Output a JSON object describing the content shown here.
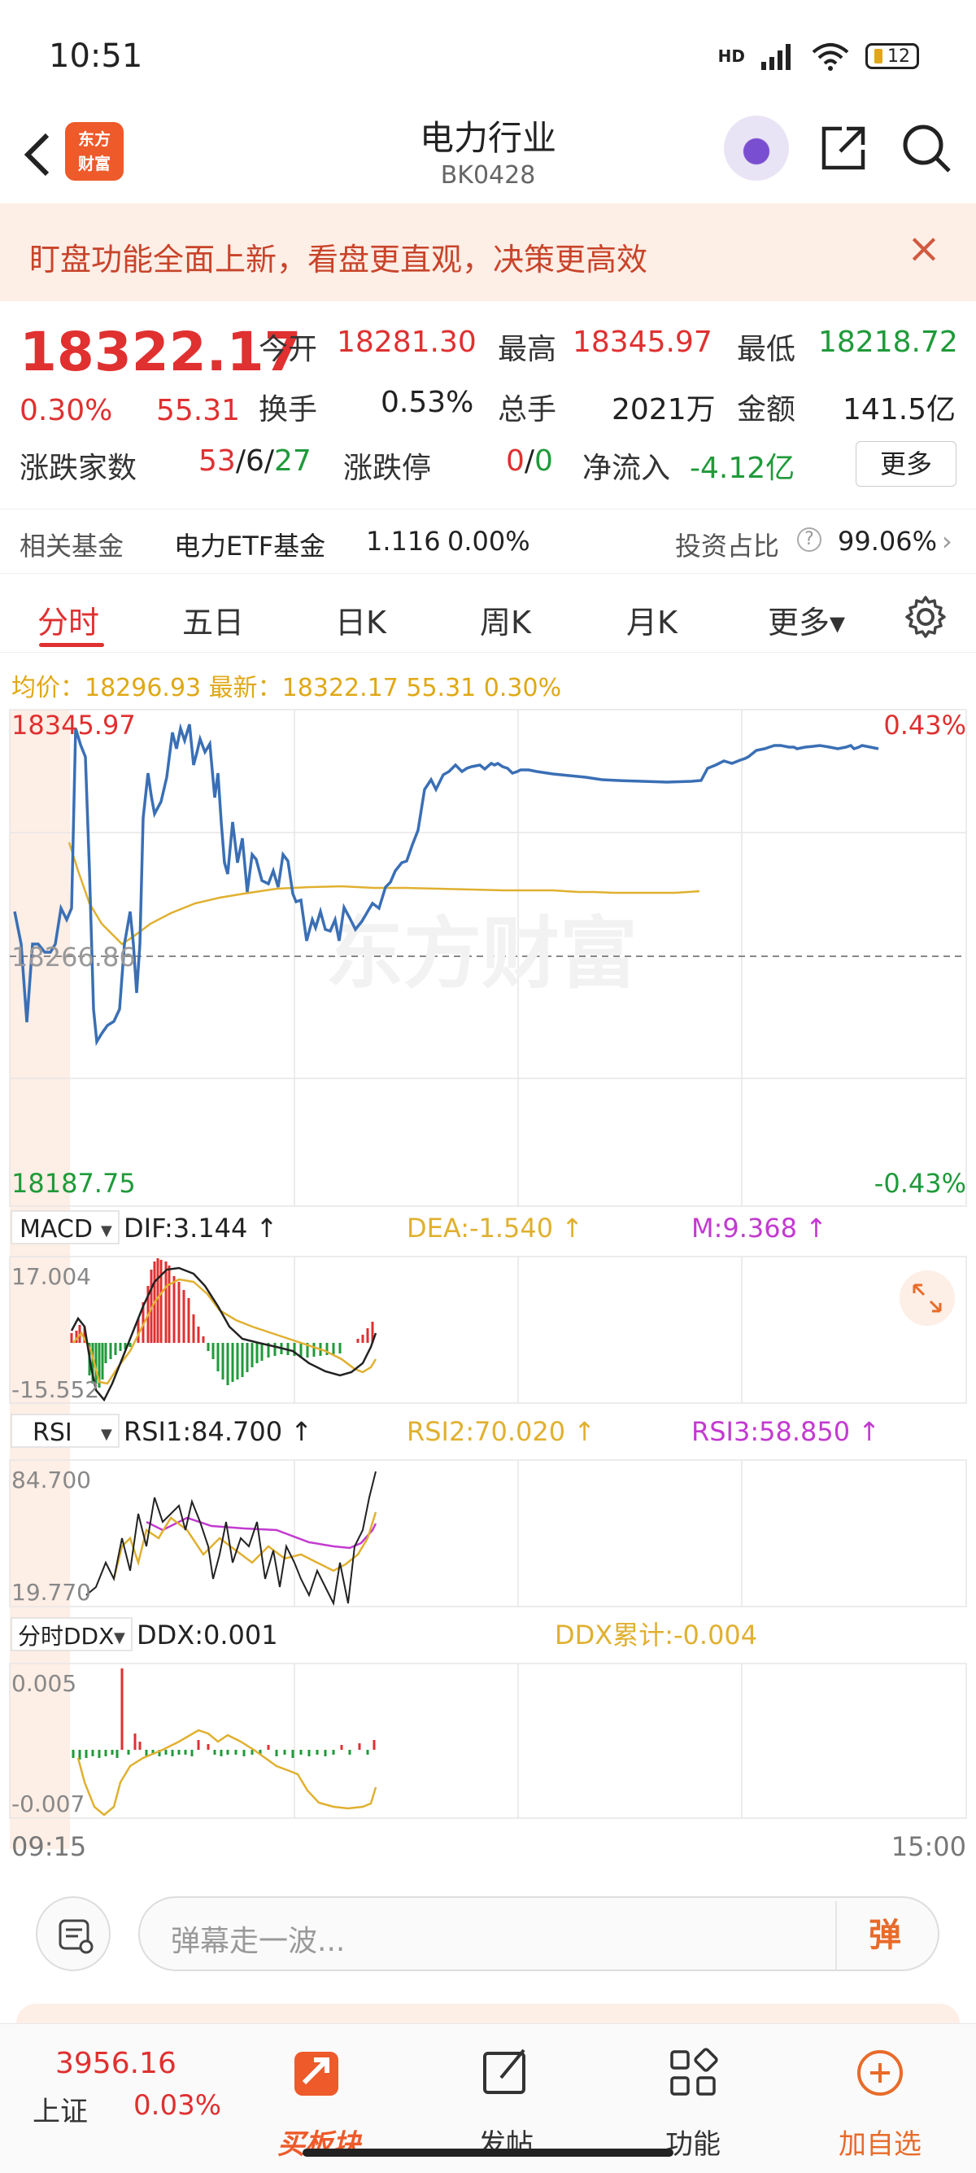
{
  "status_bar": {
    "time": "10:51",
    "network": "HD",
    "battery": "12"
  },
  "nav": {
    "title": "电力行业",
    "code": "BK0428",
    "logo_text": "东方财富"
  },
  "banner": {
    "text": "盯盘功能全面上新，看盘更直观，决策更高效",
    "close": "×"
  },
  "quote": {
    "last_price": "18322.17",
    "change_pct": "0.30%",
    "change_val": "55.31",
    "open_label": "今开",
    "open": "18281.30",
    "high_label": "最高",
    "high": "18345.97",
    "low_label": "最低",
    "low": "18218.72",
    "turnover_label": "换手",
    "turnover": "0.53%",
    "volume_label": "总手",
    "volume": "2021万",
    "amount_label": "金额",
    "amount": "141.5亿",
    "breadth_label": "涨跌家数",
    "breadth_up": "53",
    "breadth_flat": "6",
    "breadth_down": "27",
    "limit_label": "涨跌停",
    "limit_up": "0",
    "limit_down": "0",
    "netflow_label": "净流入",
    "netflow": "-4.12亿",
    "more_button": "更多"
  },
  "fund": {
    "label": "相关基金",
    "name": "电力ETF基金",
    "price": "1.116",
    "pct": "0.00%",
    "ratio_label": "投资占比",
    "ratio": "99.06%"
  },
  "tabs": [
    {
      "label": "分时",
      "active": true
    },
    {
      "label": "五日"
    },
    {
      "label": "日K"
    },
    {
      "label": "周K"
    },
    {
      "label": "月K"
    },
    {
      "label": "更多▾"
    }
  ],
  "info_line": {
    "text": "均价：18296.93 最新：18322.17 55.31 0.30%"
  },
  "main_chart": {
    "y_top": "18345.97",
    "y_mid": "18266.86",
    "y_bottom": "18187.75",
    "pct_top": "0.43%",
    "pct_bottom": "-0.43%",
    "watermark": "东方财富",
    "time_start": "09:15",
    "time_end": "15:00"
  },
  "macd": {
    "selector": "MACD",
    "dif": "DIF:3.144 ↑",
    "dea": "DEA:-1.540 ↑",
    "m": "M:9.368 ↑",
    "y_top": "17.004",
    "y_bottom": "-15.552"
  },
  "rsi": {
    "selector": "RSI",
    "rsi1": "RSI1:84.700 ↑",
    "rsi2": "RSI2:70.020 ↑",
    "rsi3": "RSI3:58.850 ↑",
    "y_top": "84.700",
    "y_bottom": "19.770"
  },
  "ddx": {
    "selector": "分时DDX",
    "ddx": "DDX:0.001",
    "ddx_sum": "DDX累计:-0.004",
    "y_top": "0.005",
    "y_bottom": "-0.007"
  },
  "comment": {
    "placeholder": "弹幕走一波...",
    "danmu_button": "弹"
  },
  "bottom_bar": {
    "index_price": "3956.16",
    "index_name": "上证",
    "index_pct": "0.03%",
    "items": [
      {
        "label": "买板块"
      },
      {
        "label": "发帖"
      },
      {
        "label": "功能"
      },
      {
        "label": "加自选"
      }
    ]
  },
  "colors": {
    "up": "#e03030",
    "down": "#1f9a3a",
    "price_line": "#3a6fb5",
    "avg_line": "#e0b030",
    "accent": "#e86b2a"
  }
}
